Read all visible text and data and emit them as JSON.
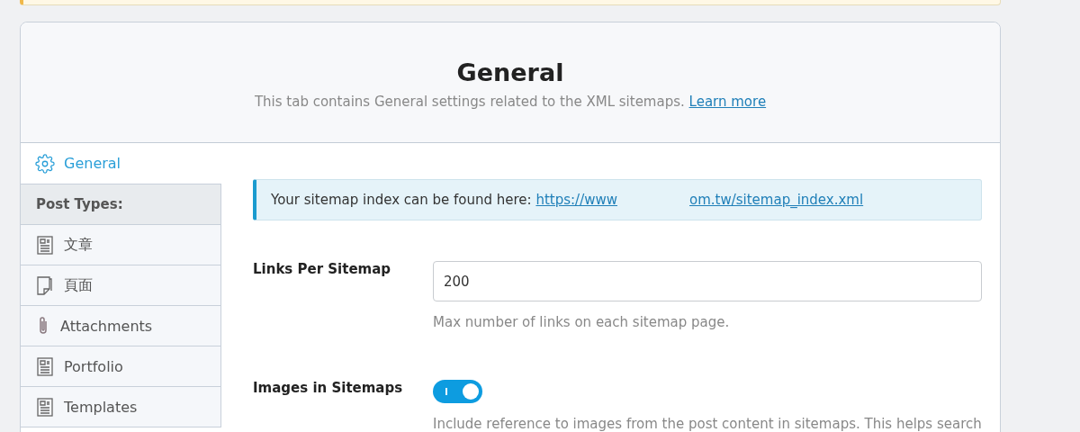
{
  "header": {
    "title": "General",
    "description": "This tab contains General settings related to the XML sitemaps.",
    "link": "Learn more"
  },
  "sidebar": {
    "general": {
      "label": "General",
      "selected": true
    },
    "section_heading": "Post Types:",
    "items": [
      {
        "label": "文章",
        "kind": "post",
        "selected": false
      },
      {
        "label": "頁面",
        "kind": "page",
        "selected": false
      },
      {
        "label": "Attachments",
        "kind": "attachment",
        "selected": false
      },
      {
        "label": "Portfolio",
        "kind": "post",
        "selected": false
      },
      {
        "label": "Templates",
        "kind": "post",
        "selected": false
      }
    ]
  },
  "notice": {
    "text": "Your sitemap index can be found here:",
    "url_start": "https://www",
    "url_end": "om.tw/sitemap_index.xml"
  },
  "settings": [
    {
      "kind": "input",
      "label": "Links Per Sitemap",
      "value": "200",
      "help": "Max number of links on each sitemap page."
    },
    {
      "kind": "toggle",
      "label": "Images in Sitemaps",
      "on": true,
      "help": "Include reference to images from the post content in sitemaps. This helps search"
    }
  ]
}
